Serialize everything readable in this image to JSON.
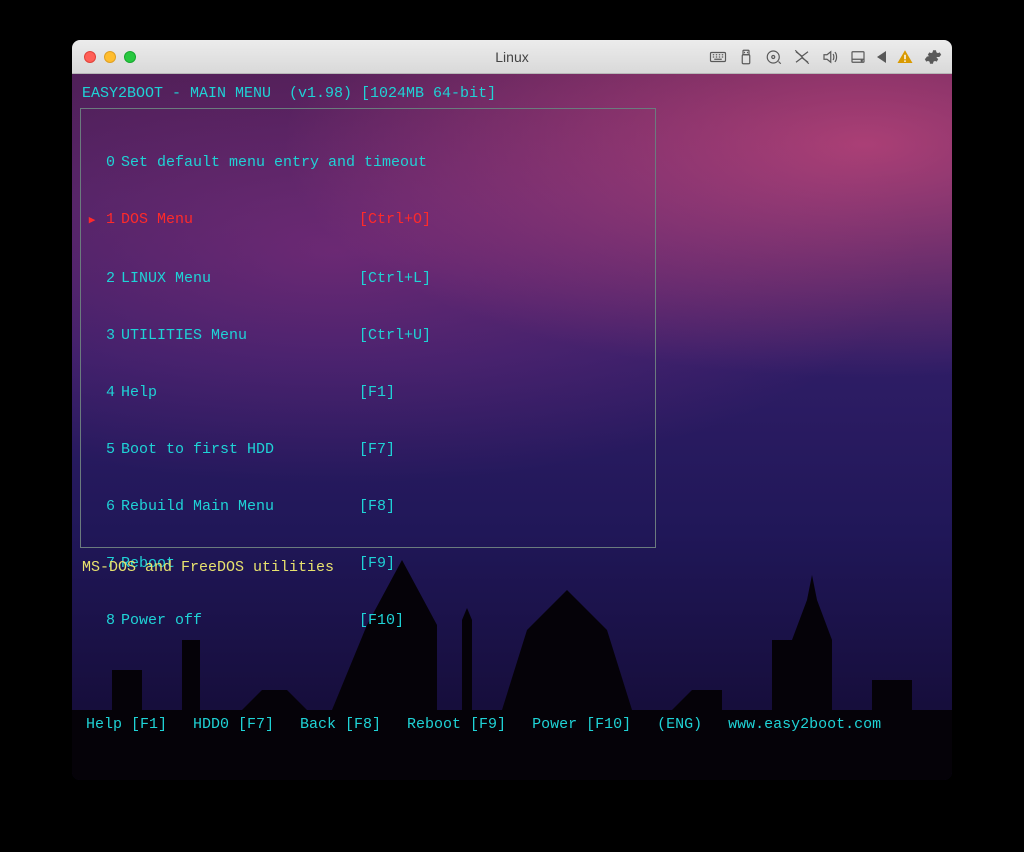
{
  "window": {
    "title": "Linux"
  },
  "bootloader": {
    "header": "EASY2BOOT - MAIN MENU  (v1.98) [1024MB 64-bit]",
    "selected_index": 1,
    "items": [
      {
        "index": "0",
        "label": "Set default menu entry and timeout",
        "key": ""
      },
      {
        "index": "1",
        "label": "DOS Menu",
        "key": "[Ctrl+O]"
      },
      {
        "index": "2",
        "label": "LINUX Menu",
        "key": "[Ctrl+L]"
      },
      {
        "index": "3",
        "label": "UTILITIES Menu",
        "key": "[Ctrl+U]"
      },
      {
        "index": "4",
        "label": "Help",
        "key": "[F1]"
      },
      {
        "index": "5",
        "label": "Boot to first HDD",
        "key": "[F7]"
      },
      {
        "index": "6",
        "label": "Rebuild Main Menu",
        "key": "[F8]"
      },
      {
        "index": "7",
        "label": "Reboot",
        "key": "[F9]"
      },
      {
        "index": "8",
        "label": "Power off",
        "key": "[F10]"
      }
    ],
    "description": "MS-DOS and FreeDOS utilities",
    "footer": [
      "Help [F1]",
      "HDD0 [F7]",
      "Back [F8]",
      "Reboot [F9]",
      "Power [F10]",
      "(ENG)",
      "www.easy2boot.com"
    ]
  }
}
